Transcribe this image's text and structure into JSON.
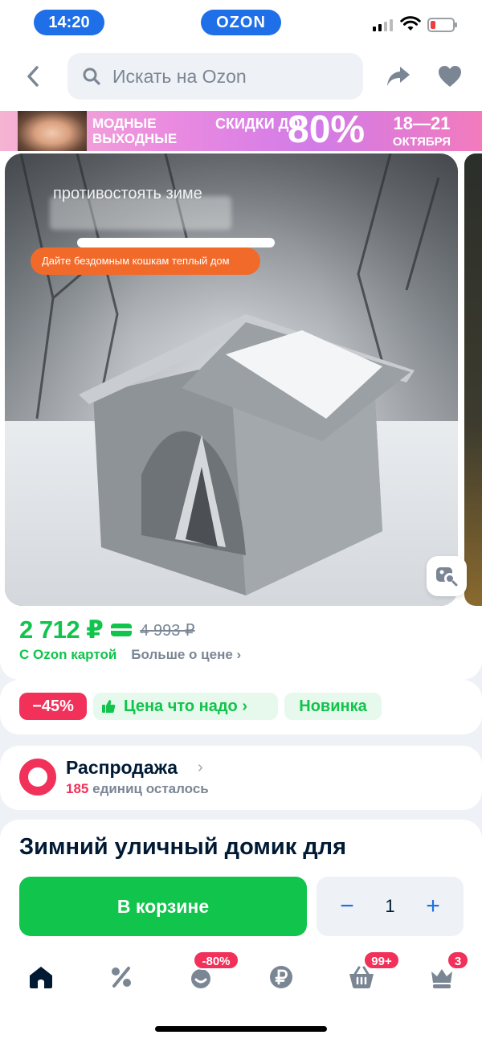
{
  "status_bar": {
    "time": "14:20",
    "app_badge": "OZON"
  },
  "header": {
    "search_placeholder": "Искать на Ozon"
  },
  "banner": {
    "line1": "МОДНЫЕ ВЫХОДНЫЕ",
    "line2": "СКИДКИ ДО",
    "percent": "80%",
    "dates": "18—21",
    "month": "ОКТЯБРЯ"
  },
  "gallery": {
    "overlay_title": "противостоять зиме",
    "overlay_pill": "Дайте бездомным кошкам теплый дом"
  },
  "price": {
    "current": "2 712 ₽",
    "old": "4 993 ₽",
    "with_card": "С Ozon картой",
    "more": "Больше о цене ›"
  },
  "badges": {
    "discount": "−45%",
    "good_price": "Цена что надо ›",
    "new": "Новинка"
  },
  "sale": {
    "title": "Распродажа",
    "count": "185",
    "remaining": "единиц осталось"
  },
  "product": {
    "title": "Зимний уличный домик для",
    "cart_label": "В корзине",
    "quantity": "1",
    "minus": "−",
    "plus": "+"
  },
  "tabbar": {
    "badges": {
      "fresh": "-80%",
      "cart": "99+",
      "profile": "3"
    }
  },
  "colors": {
    "accent_blue": "#1e6fe8",
    "ozon_green": "#10c44c",
    "discount_red": "#f1315a"
  }
}
